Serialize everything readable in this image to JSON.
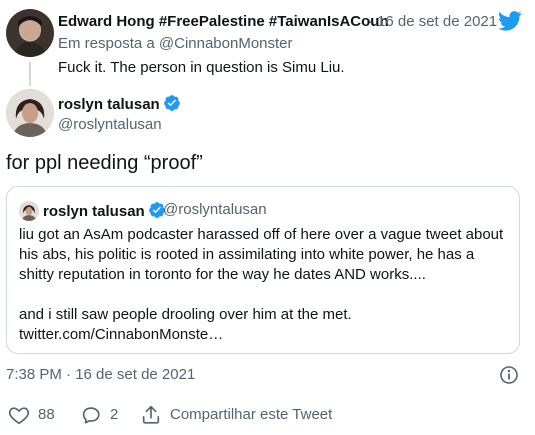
{
  "colors": {
    "accent": "#1d9bf0",
    "muted": "#536471",
    "border": "#cfd9de"
  },
  "reply": {
    "author_name": "Edward Hong #FreePalestine #TaiwanIsACoun",
    "date_sep": "·",
    "date": "16 de set de 2021",
    "in_reply_prefix": "Em resposta a ",
    "in_reply_handle": "@CinnabonMonster",
    "text": "Fuck it. The person in question is Simu Liu."
  },
  "tweet": {
    "author_name": "roslyn talusan",
    "handle": "@roslyntalusan",
    "text": "for ppl needing “proof”",
    "timestamp": "7:38 PM · 16 de set de 2021"
  },
  "quote": {
    "author_name": "roslyn talusan",
    "handle": "@roslyntalusan",
    "line1": "liu got an AsAm podcaster harassed off of here over a vague tweet about",
    "line2": "his abs, his politic is rooted in assimilating into white power, he has a",
    "line3": "shitty reputation in toronto for the way he dates AND works....",
    "line4": "and i still saw people drooling over him at the met.",
    "line5": "twitter.com/CinnabonMonste…"
  },
  "actions": {
    "likes": "88",
    "replies": "2",
    "share_label": "Compartilhar este Tweet"
  },
  "icons": {
    "brand": "twitter-bird-icon",
    "verified": "verified-badge-icon",
    "info": "info-icon",
    "like": "heart-icon",
    "reply": "reply-bubble-icon",
    "share": "share-icon"
  }
}
